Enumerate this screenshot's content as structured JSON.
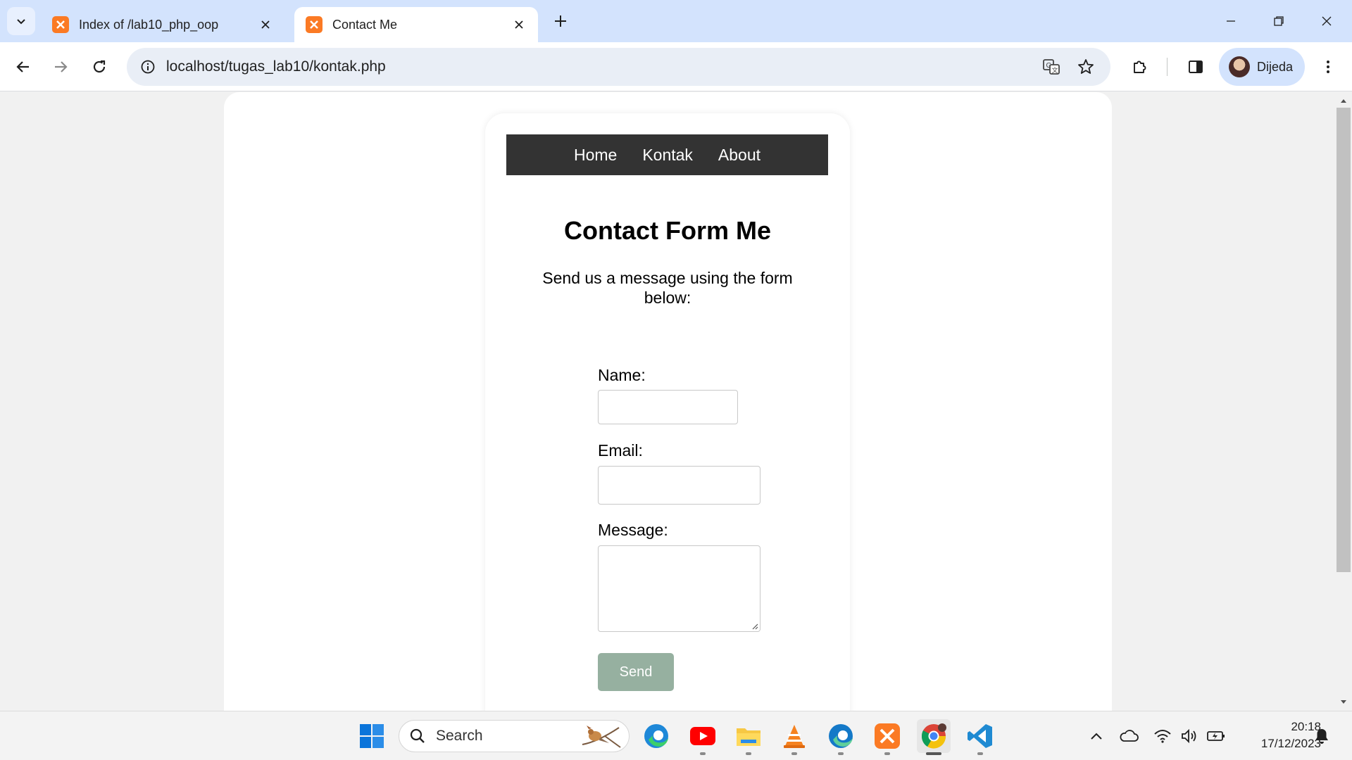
{
  "browser": {
    "tabs": [
      {
        "title": "Index of /lab10_php_oop",
        "active": false
      },
      {
        "title": "Contact Me",
        "active": true
      }
    ],
    "url": "localhost/tugas_lab10/kontak.php",
    "profile_name": "Dijeda"
  },
  "page": {
    "nav": [
      "Home",
      "Kontak",
      "About"
    ],
    "title": "Contact Form Me",
    "subtitle": "Send us a message using the form below:",
    "form": {
      "name_label": "Name:",
      "email_label": "Email:",
      "message_label": "Message:",
      "name_value": "",
      "email_value": "",
      "message_value": "",
      "submit_label": "Send"
    }
  },
  "taskbar": {
    "search_placeholder": "Search",
    "time": "20:18",
    "date": "17/12/2023"
  },
  "colors": {
    "tabstrip": "#d3e3fd",
    "navbar": "#333333",
    "send_button": "#96b0a0",
    "xampp_orange": "#fb7a24"
  }
}
